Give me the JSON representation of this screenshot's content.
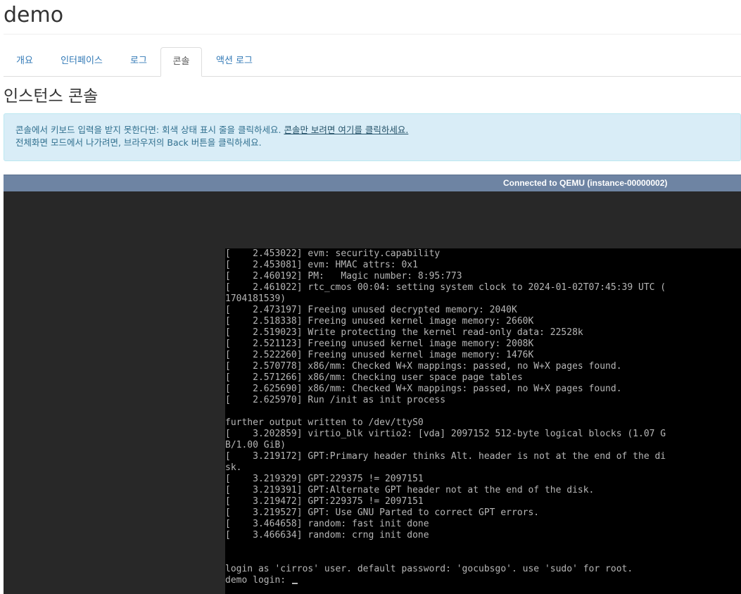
{
  "page": {
    "title": "demo"
  },
  "tabs": [
    {
      "label": "개요",
      "active": false
    },
    {
      "label": "인터페이스",
      "active": false
    },
    {
      "label": "로그",
      "active": false
    },
    {
      "label": "콘솔",
      "active": true
    },
    {
      "label": "액션 로그",
      "active": false
    }
  ],
  "section": {
    "title": "인스턴스 콘솔"
  },
  "alert": {
    "line1_text": "콘솔에서 키보드 입력을 받지 못한다면: 회색 상태 표시 줄을 클릭하세요.",
    "line1_link": "콘솔만 보려면 여기를 클릭하세요.",
    "line2_text": "전체화면 모드에서 나가려면, 브라우저의 Back 버튼을 클릭하세요."
  },
  "console": {
    "status": "Connected to QEMU (instance-00000002)",
    "lines": [
      "[    2.453022] evm: security.capability",
      "[    2.453081] evm: HMAC attrs: 0x1",
      "[    2.460192] PM:   Magic number: 8:95:773",
      "[    2.461022] rtc_cmos 00:04: setting system clock to 2024-01-02T07:45:39 UTC (",
      "1704181539)",
      "[    2.473197] Freeing unused decrypted memory: 2040K",
      "[    2.518338] Freeing unused kernel image memory: 2660K",
      "[    2.519023] Write protecting the kernel read-only data: 22528k",
      "[    2.521123] Freeing unused kernel image memory: 2008K",
      "[    2.522260] Freeing unused kernel image memory: 1476K",
      "[    2.570778] x86/mm: Checked W+X mappings: passed, no W+X pages found.",
      "[    2.571266] x86/mm: Checking user space page tables",
      "[    2.625690] x86/mm: Checked W+X mappings: passed, no W+X pages found.",
      "[    2.625970] Run /init as init process",
      "",
      "further output written to /dev/ttyS0",
      "[    3.202859] virtio_blk virtio2: [vda] 2097152 512-byte logical blocks (1.07 G",
      "B/1.00 GiB)",
      "[    3.219172] GPT:Primary header thinks Alt. header is not at the end of the di",
      "sk.",
      "[    3.219329] GPT:229375 != 2097151",
      "[    3.219391] GPT:Alternate GPT header not at the end of the disk.",
      "[    3.219472] GPT:229375 != 2097151",
      "[    3.219527] GPT: Use GNU Parted to correct GPT errors.",
      "[    3.464658] random: fast init done",
      "[    3.466634] random: crng init done",
      "",
      "",
      "login as 'cirros' user. default password: 'gocubsgo'. use 'sudo' for root.",
      "demo login: "
    ]
  },
  "colors": {
    "link": "#337ab7",
    "alert_bg": "#d9edf7",
    "alert_text": "#31708f",
    "status_bar": "#6e84a3",
    "console_bg": "#282828",
    "screen_bg": "#000000",
    "screen_text": "#b6b6b6"
  }
}
